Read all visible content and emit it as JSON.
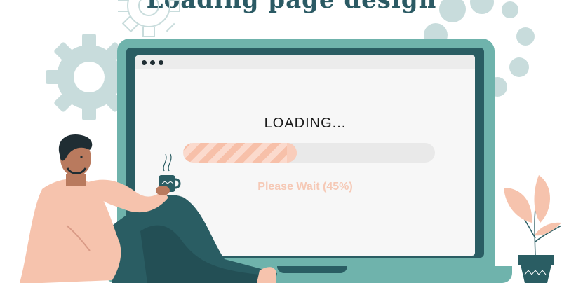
{
  "headline": "Loading page design",
  "screen": {
    "loading_label": "LOADING...",
    "status_text": "Please Wait (45%)",
    "progress": 0.45
  },
  "colors": {
    "laptop_body": "#6fb3ac",
    "laptop_bezel": "#2a5d63",
    "progress_fill": "#f7c0a9",
    "progress_track": "#e9e9e9",
    "status_text": "#f6c9b6",
    "gear": "#c8dcdc"
  },
  "icons": [
    "gear-icon",
    "coffee-cup-icon",
    "plant-icon",
    "window-dots-icon"
  ]
}
